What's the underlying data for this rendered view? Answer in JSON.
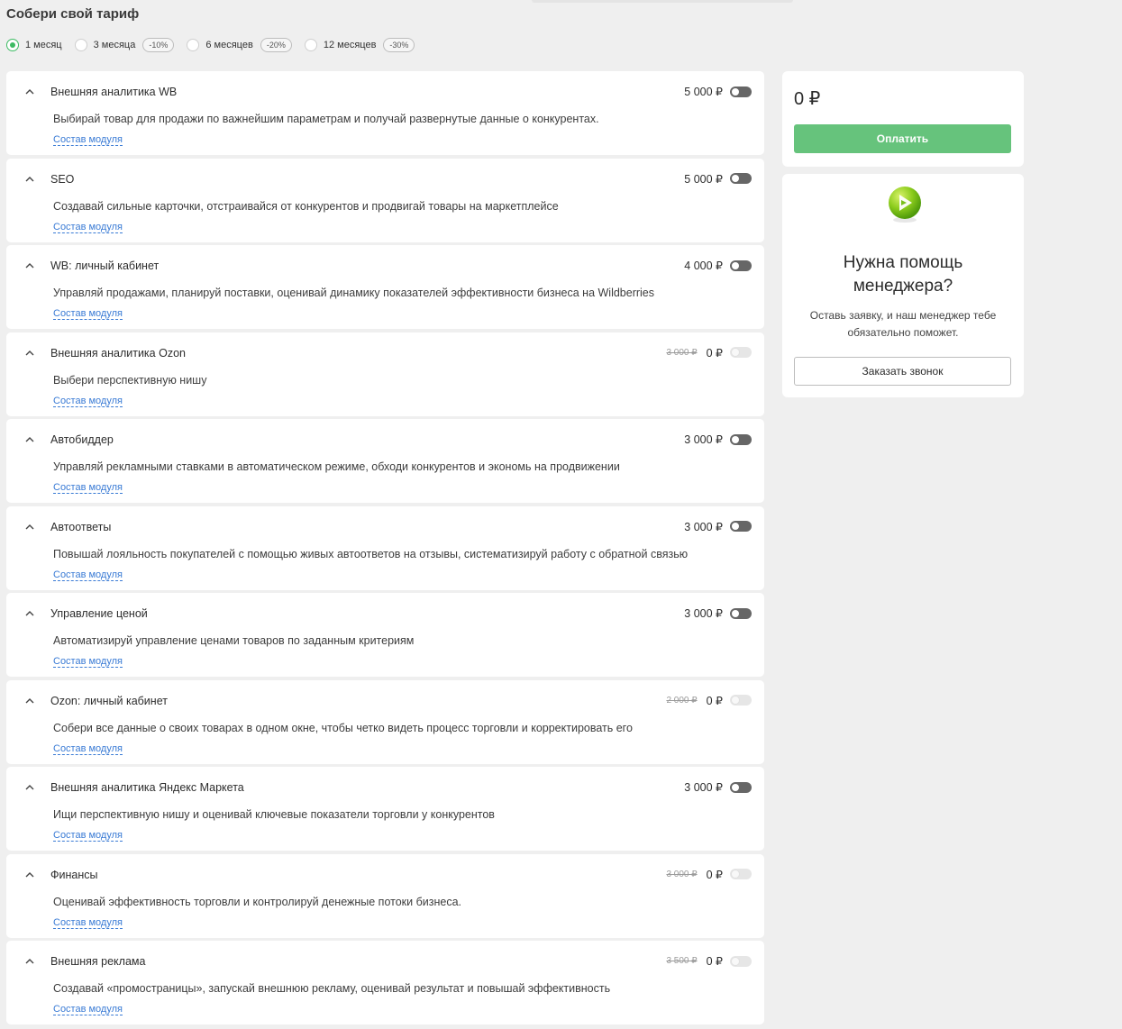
{
  "page": {
    "title": "Собери свой тариф"
  },
  "periods": [
    {
      "label": "1 месяц",
      "discount": "",
      "selected": true
    },
    {
      "label": "3 месяца",
      "discount": "-10%",
      "selected": false
    },
    {
      "label": "6 месяцев",
      "discount": "-20%",
      "selected": false
    },
    {
      "label": "12 месяцев",
      "discount": "-30%",
      "selected": false
    }
  ],
  "module_link_label": "Состав модуля",
  "modules": [
    {
      "name": "Внешняя аналитика WB",
      "desc": "Выбирай товар для продажи по важнейшим параметрам и получай развернутые данные о конкурентах.",
      "old_price": "",
      "price": "5 000 ₽",
      "toggle_disabled": false
    },
    {
      "name": "SEO",
      "desc": "Создавай сильные карточки, отстраивайся от конкурентов и продвигай товары на маркетплейсе",
      "old_price": "",
      "price": "5 000 ₽",
      "toggle_disabled": false
    },
    {
      "name": "WB: личный кабинет",
      "desc": "Управляй продажами, планируй поставки, оценивай динамику показателей эффективности бизнеса на Wildberries",
      "old_price": "",
      "price": "4 000 ₽",
      "toggle_disabled": false
    },
    {
      "name": "Внешняя аналитика Ozon",
      "desc": "Выбери перспективную нишу",
      "old_price": "3 000 ₽",
      "price": "0 ₽",
      "toggle_disabled": true
    },
    {
      "name": "Автобиддер",
      "desc": "Управляй рекламными ставками в автоматическом режиме, обходи конкурентов и экономь на продвижении",
      "old_price": "",
      "price": "3 000 ₽",
      "toggle_disabled": false
    },
    {
      "name": "Автоответы",
      "desc": "Повышай лояльность покупателей с помощью живых автоответов на отзывы, систематизируй работу с обратной связью",
      "old_price": "",
      "price": "3 000 ₽",
      "toggle_disabled": false
    },
    {
      "name": "Управление ценой",
      "desc": "Автоматизируй управление ценами товаров по заданным критериям",
      "old_price": "",
      "price": "3 000 ₽",
      "toggle_disabled": false
    },
    {
      "name": "Ozon: личный кабинет",
      "desc": "Собери все данные о своих товарах в одном окне, чтобы четко видеть процесс торговли и корректировать его",
      "old_price": "2 000 ₽",
      "price": "0 ₽",
      "toggle_disabled": true
    },
    {
      "name": "Внешняя аналитика Яндекс Маркета",
      "desc": "Ищи перспективную нишу и оценивай ключевые показатели торговли у конкурентов",
      "old_price": "",
      "price": "3 000 ₽",
      "toggle_disabled": false
    },
    {
      "name": "Финансы",
      "desc": "Оценивай эффективность торговли и контролируй денежные потоки бизнеса.",
      "old_price": "3 000 ₽",
      "price": "0 ₽",
      "toggle_disabled": true
    },
    {
      "name": "Внешняя реклама",
      "desc": "Создавай «промостраницы», запускай внешнюю рекламу, оценивай результат и повышай эффективность",
      "old_price": "3 500 ₽",
      "price": "0 ₽",
      "toggle_disabled": true
    }
  ],
  "summary": {
    "total": "0 ₽",
    "pay_label": "Оплатить"
  },
  "help": {
    "title_line1": "Нужна помощь",
    "title_line2": "менеджера?",
    "text": "Оставь заявку, и наш менеджер тебе обязательно поможет.",
    "call_label": "Заказать звонок"
  },
  "colors": {
    "accent": "#3dbb63",
    "pay_button": "#66c37c",
    "link": "#3a7bd5"
  }
}
